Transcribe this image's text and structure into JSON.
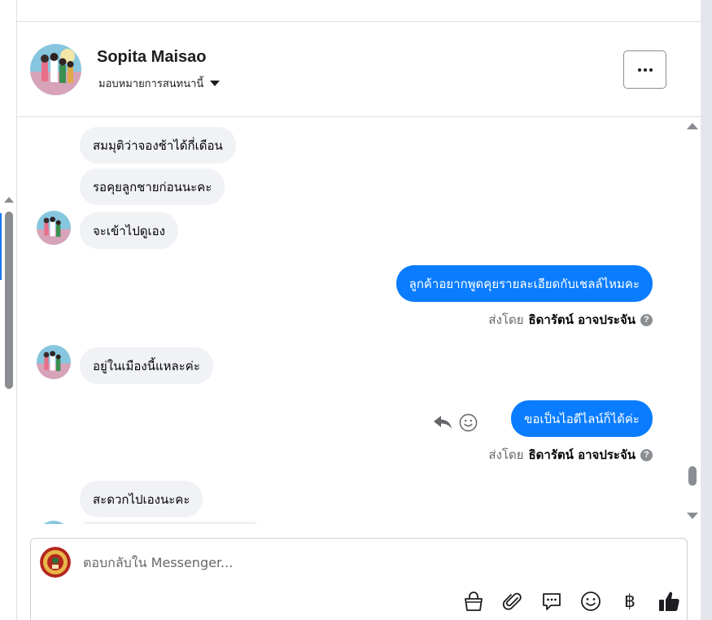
{
  "conversation": {
    "contact_name": "Sopita Maisao",
    "assign_label": "มอบหมายการสนทนานี้"
  },
  "messages": [
    {
      "direction": "in",
      "text": "สมมุติว่าจองช้าได้กี่เดือน"
    },
    {
      "direction": "in",
      "text": "รอคุยลูกชายก่อนนะคะ"
    },
    {
      "direction": "in",
      "text": "จะเข้าไปดูเอง"
    },
    {
      "direction": "out",
      "text": "ลูกค้าอยากพูดคุยรายละเอียดกับเชลล์ไหมคะ"
    },
    {
      "direction": "in",
      "text": "อยู่ในเมืองนี้แหละค่ะ"
    },
    {
      "direction": "out",
      "text": "ขอเป็นไอดีไลน์ก็ได้ค่ะ"
    },
    {
      "direction": "in",
      "text": "สะดวกไปเองนะคะ"
    }
  ],
  "sent_by": {
    "prefix": "ส่งโดย",
    "agent_name": "ธิดารัตน์ อาจประจัน",
    "help": "?"
  },
  "composer": {
    "placeholder": "ตอบกลับใน Messenger...",
    "baht_symbol": "฿"
  },
  "colors": {
    "outgoing_bubble": "#0a7cff",
    "incoming_bubble": "#f0f2f5",
    "like_icon": "#1c1e21"
  },
  "icons": [
    "more-icon",
    "caret-down-icon",
    "reply-icon",
    "reaction-icon",
    "help-icon",
    "shop-bag-icon",
    "attachment-icon",
    "saved-reply-icon",
    "emoji-icon",
    "baht-icon",
    "like-icon"
  ]
}
